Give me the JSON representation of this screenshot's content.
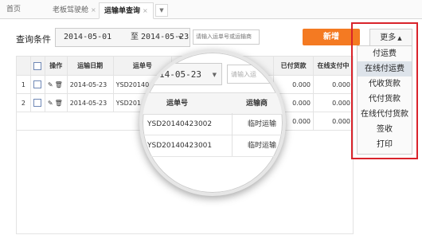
{
  "tabs": {
    "home": "首页",
    "tab1": "老板驾驶舱",
    "tab2": "运输单查询",
    "close": "×",
    "dropdown": "▼"
  },
  "query": {
    "label": "查询条件",
    "date_from": "2014-05-01",
    "date_to_label": "至",
    "date_to": "2014-05-23",
    "date_caret": "▼",
    "search_placeholder": "请输入运单号或运输商"
  },
  "buttons": {
    "add": "新增",
    "more": "更多",
    "more_arrow": "▲"
  },
  "table": {
    "headers": [
      "操作",
      "运输日期",
      "运单号",
      "已付货款",
      "在线支付中"
    ],
    "rows": [
      {
        "index": "1",
        "date": "2014-05-23",
        "waybill": "YSD20140",
        "paid": "0.000",
        "online": "0.000"
      },
      {
        "index": "2",
        "date": "2014-05-23",
        "waybill": "YSD201",
        "paid": "0.000",
        "online": "0.000"
      }
    ],
    "trailing_total": "0.000",
    "edit_glyph": "✎",
    "trash_glyph": "🗑"
  },
  "magnifier": {
    "date": "14-05-23",
    "caret": "▼",
    "search_placeholder": "请输入运",
    "col_waybill": "运单号",
    "col_carrier": "运输商",
    "rows": [
      {
        "waybill": "YSD20140423002",
        "carrier": "临时运输"
      },
      {
        "waybill": "YSD20140423001",
        "carrier": "临时运输"
      }
    ]
  },
  "more_menu": {
    "items": [
      "付运费",
      "在线付运费",
      "代收货款",
      "代付货款",
      "在线代付货款",
      "签收",
      "打印"
    ],
    "active_index": 1
  },
  "colors": {
    "accent_orange": "#f47a22",
    "highlight_red": "#d9232b",
    "checkbox_blue": "#6f88b5"
  }
}
